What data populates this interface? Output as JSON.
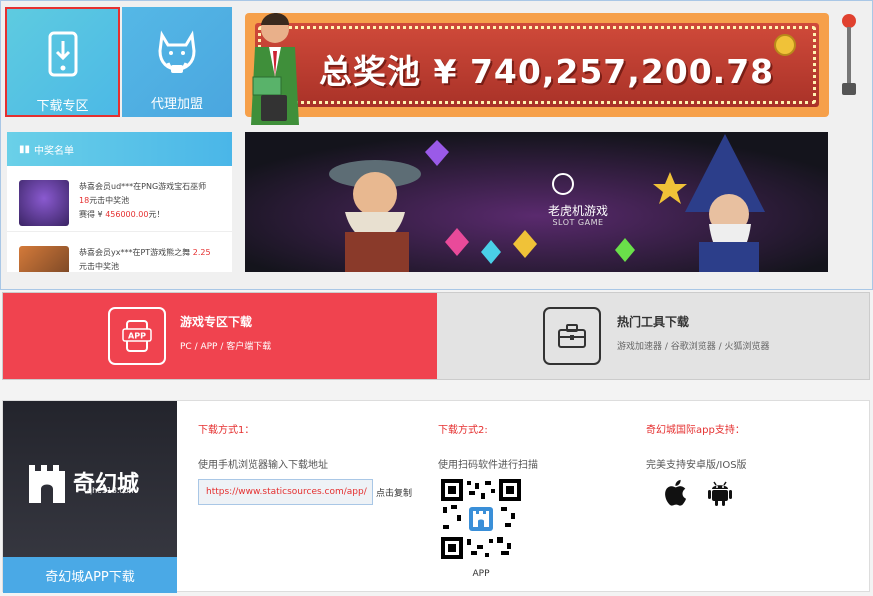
{
  "tiles": {
    "download_label": "下载专区",
    "agent_label": "代理加盟"
  },
  "jackpot": {
    "text": "总奖池 ¥ 740,257,200.78"
  },
  "winners": {
    "heading": "中奖名单",
    "items": [
      {
        "line1": "恭喜会员ud***在PNG游戏宝石巫师",
        "amount1": "18",
        "line2": "元击中奖池",
        "line3_prefix": "赛得 ¥",
        "amount2": "456000.00",
        "line3_suffix": "元！"
      },
      {
        "line1": "恭喜会员yx***在PT游戏熊之舞",
        "amount1": "2.25",
        "line2": "元击中奖池"
      }
    ]
  },
  "slot_banner": {
    "title": "老虎机游戏",
    "subtitle": "SLOT GAME"
  },
  "download_tabs": [
    {
      "title": "游戏专区下载",
      "subtitle": "PC / APP / 客户端下载",
      "icon_text": "APP"
    },
    {
      "title": "热门工具下载",
      "subtitle": "游戏加速器 / 谷歌浏览器 / 火狐浏览器"
    }
  ],
  "brand": {
    "name": "奇幻城",
    "url": "qhc118.com",
    "button": "奇幻城APP下载"
  },
  "methods": [
    {
      "title": "下载方式1：",
      "desc": "使用手机浏览器输入下载地址"
    },
    {
      "title": "下载方式2:",
      "desc": "使用扫码软件进行扫描"
    },
    {
      "title": "奇幻城国际app支持：",
      "desc": "完美支持安卓版/IOS版"
    }
  ],
  "url_field": {
    "value": "https://www.staticsources.com/app/",
    "copy_label": "点击复制"
  },
  "qr": {
    "label": "APP"
  },
  "colors": {
    "accent_red": "#f0434f",
    "accent_blue": "#4aa9e6",
    "highlight_text": "#e53030"
  }
}
